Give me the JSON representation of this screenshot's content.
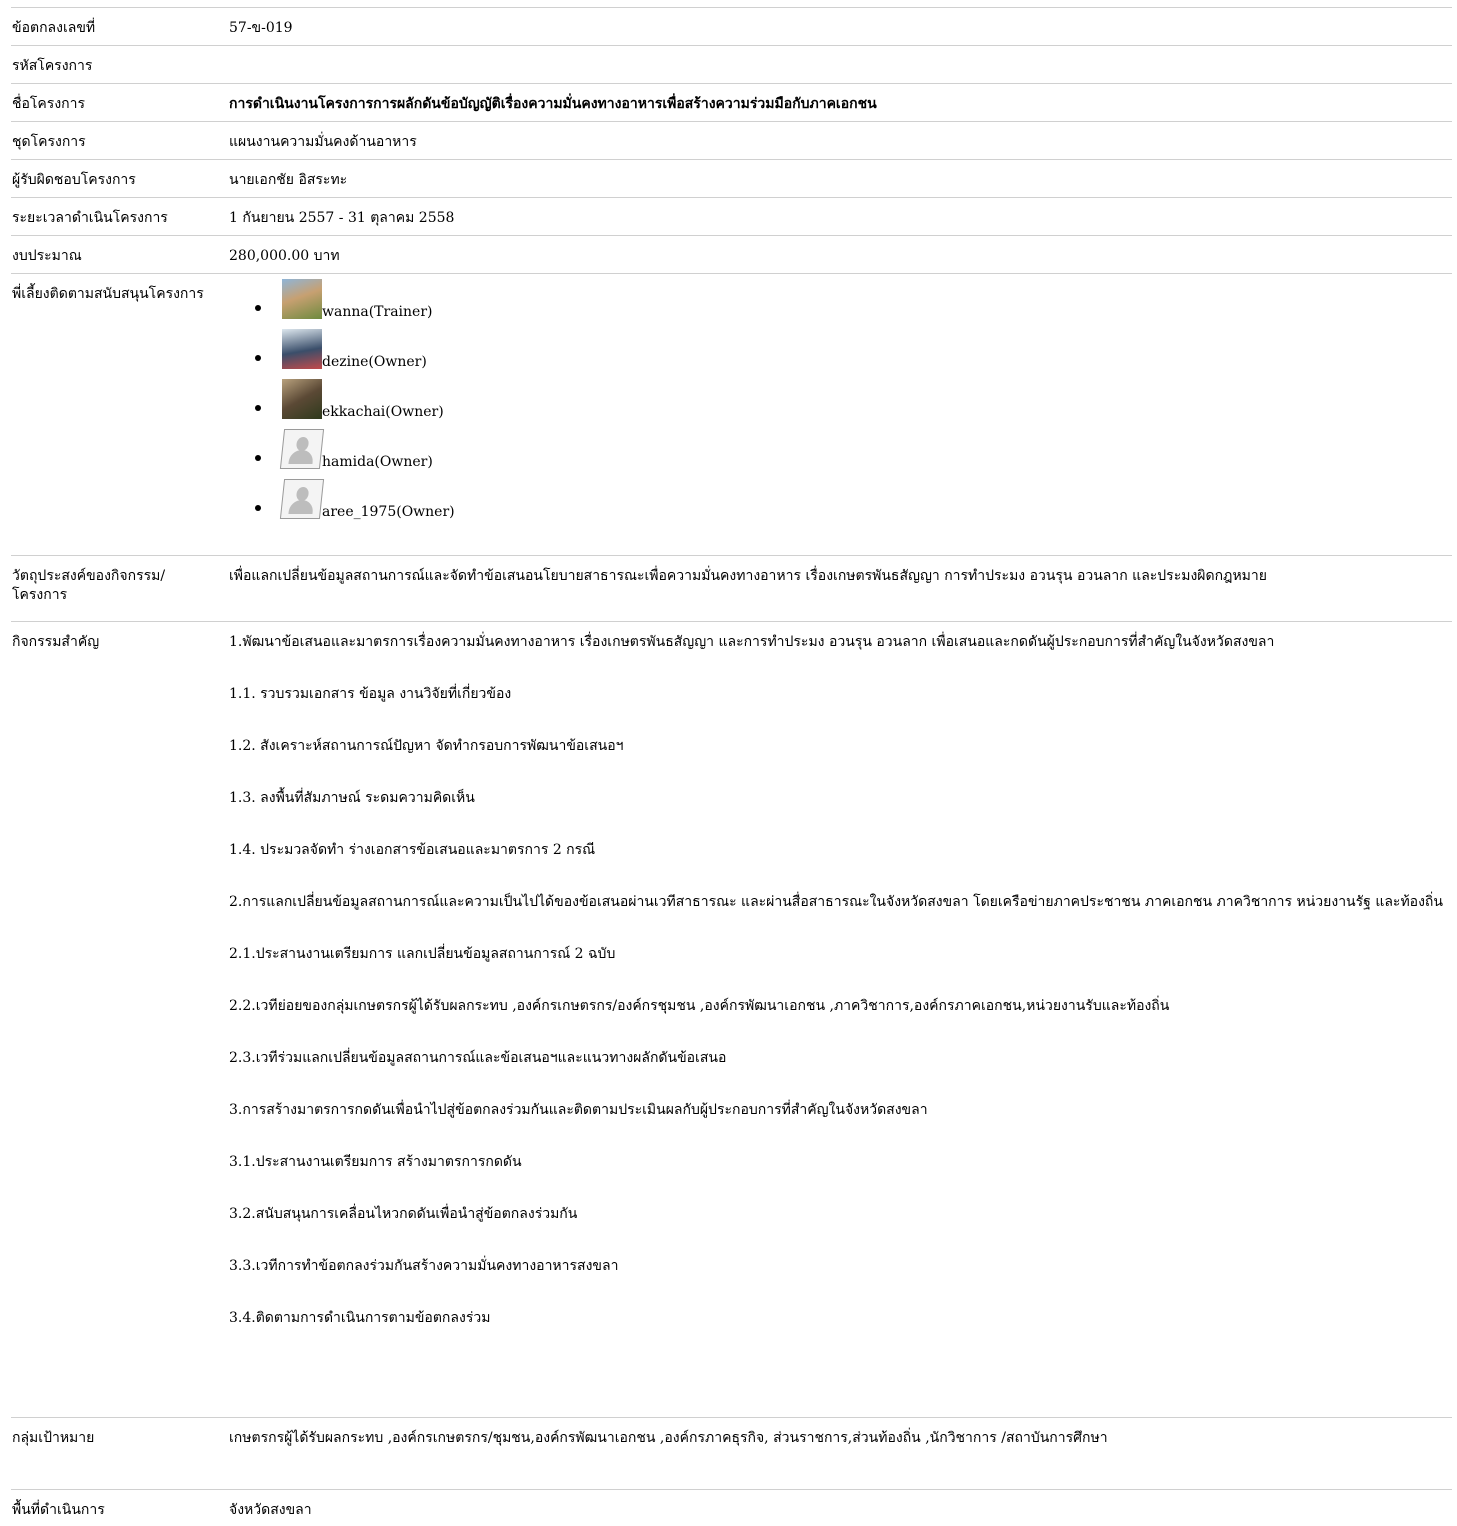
{
  "fields": {
    "agreement_no": {
      "label": "ข้อตกลงเลขที่",
      "value": "57-ข-019"
    },
    "project_code": {
      "label": "รหัสโครงการ",
      "value": ""
    },
    "project_name": {
      "label": "ชื่อโครงการ",
      "value": "การดำเนินงานโครงการการผลักดันข้อบัญญัติเรื่องความมั่นคงทางอาหารเพื่อสร้างความร่วมมือกับภาคเอกชน"
    },
    "project_set": {
      "label": "ชุดโครงการ",
      "value": "แผนงานความมั่นคงด้านอาหาร"
    },
    "responsible": {
      "label": "ผู้รับผิดชอบโครงการ",
      "value": "นายเอกชัย อิสระทะ"
    },
    "duration": {
      "label": "ระยะเวลาดำเนินโครงการ",
      "value": "1 กันยายน 2557 - 31 ตุลาคม 2558"
    },
    "budget": {
      "label": "งบประมาณ",
      "value": "280,000.00 บาท"
    },
    "mentors": {
      "label": "พี่เลี้ยงติดตามสนับสนุนโครงการ",
      "items": [
        {
          "name": "wanna(Trainer)",
          "avatar": "photo"
        },
        {
          "name": "dezine(Owner)",
          "avatar": "photo"
        },
        {
          "name": "ekkachai(Owner)",
          "avatar": "photo"
        },
        {
          "name": "hamida(Owner)",
          "avatar": "placeholder-icon"
        },
        {
          "name": "aree_1975(Owner)",
          "avatar": "placeholder-icon"
        }
      ]
    },
    "objective": {
      "label": "วัตถุประสงค์ของกิจกรรม/โครงการ",
      "value": "เพื่อแลกเปลี่ยนข้อมูลสถานการณ์และจัดทำข้อเสนอนโยบายสาธารณะเพื่อความมั่นคงทางอาหาร เรื่องเกษตรพันธสัญญา การทำประมง อวนรุน อวนลาก และประมงผิดกฎหมาย"
    },
    "key_activities": {
      "label": "กิจกรรมสำคัญ",
      "items": [
        "1.พัฒนาข้อเสนอและมาตรการเรื่องความมั่นคงทางอาหาร เรื่องเกษตรพันธสัญญา และการทำประมง อวนรุน อวนลาก  เพื่อเสนอและกดดันผู้ประกอบการที่สำคัญในจังหวัดสงขลา",
        "1.1. รวบรวมเอกสาร ข้อมูล งานวิจัยที่เกี่ยวข้อง",
        "1.2. สังเคราะห์สถานการณ์ปัญหา จัดทำกรอบการพัฒนาข้อเสนอฯ",
        "1.3. ลงพื้นที่สัมภาษณ์ ระดมความคิดเห็น",
        "1.4. ประมวลจัดทำ ร่างเอกสารข้อเสนอและมาตรการ 2 กรณี",
        "2.การแลกเปลี่ยนข้อมูลสถานการณ์และความเป็นไปได้ของข้อเสนอผ่านเวทีสาธารณะ และผ่านสื่อสาธารณะในจังหวัดสงขลา โดยเครือข่ายภาคประชาชน ภาคเอกชน  ภาควิชาการ หน่วยงานรัฐ และท้องถิ่น",
        "2.1.ประสานงานเตรียมการ แลกเปลี่ยนข้อมูลสถานการณ์ 2 ฉบับ",
        "2.2.เวทีย่อยของกลุ่มเกษตรกรผู้ได้รับผลกระทบ ,องค์กรเกษตรกร/องค์กรชุมชน ,องค์กรพัฒนาเอกชน ,ภาควิชาการ,องค์กรภาคเอกชน,หน่วยงานรับและท้องถิ่น",
        "2.3.เวทีร่วมแลกเปลี่ยนข้อมูลสถานการณ์และข้อเสนอฯและแนวทางผลักดันข้อเสนอ",
        "3.การสร้างมาตรการกดดันเพื่อนำไปสู่ข้อตกลงร่วมกันและติดตามประเมินผลกับผู้ประกอบการที่สำคัญในจังหวัดสงขลา",
        "3.1.ประสานงานเตรียมการ สร้างมาตรการกดดัน",
        "3.2.สนับสนุนการเคลื่อนไหวกดดันเพื่อนำสู่ข้อตกลงร่วมกัน",
        "3.3.เวทีการทำข้อตกลงร่วมกันสร้างความมั่นคงทางอาหารสงขลา",
        "3.4.ติดตามการดำเนินการตามข้อตกลงร่วม"
      ]
    },
    "target_group": {
      "label": "กลุ่มเป้าหมาย",
      "value": "เกษตรกรผู้ได้รับผลกระทบ ,องค์กรเกษตรกร/ชุมชน,องค์กรพัฒนาเอกชน ,องค์กรภาคธุรกิจ, ส่วนราชการ,ส่วนท้องถิ่น ,นักวิชาการ /สถาบันการศึกษา"
    },
    "area": {
      "label": "พื้นที่ดำเนินการ",
      "value": "จังหวัดสงขลา"
    }
  }
}
